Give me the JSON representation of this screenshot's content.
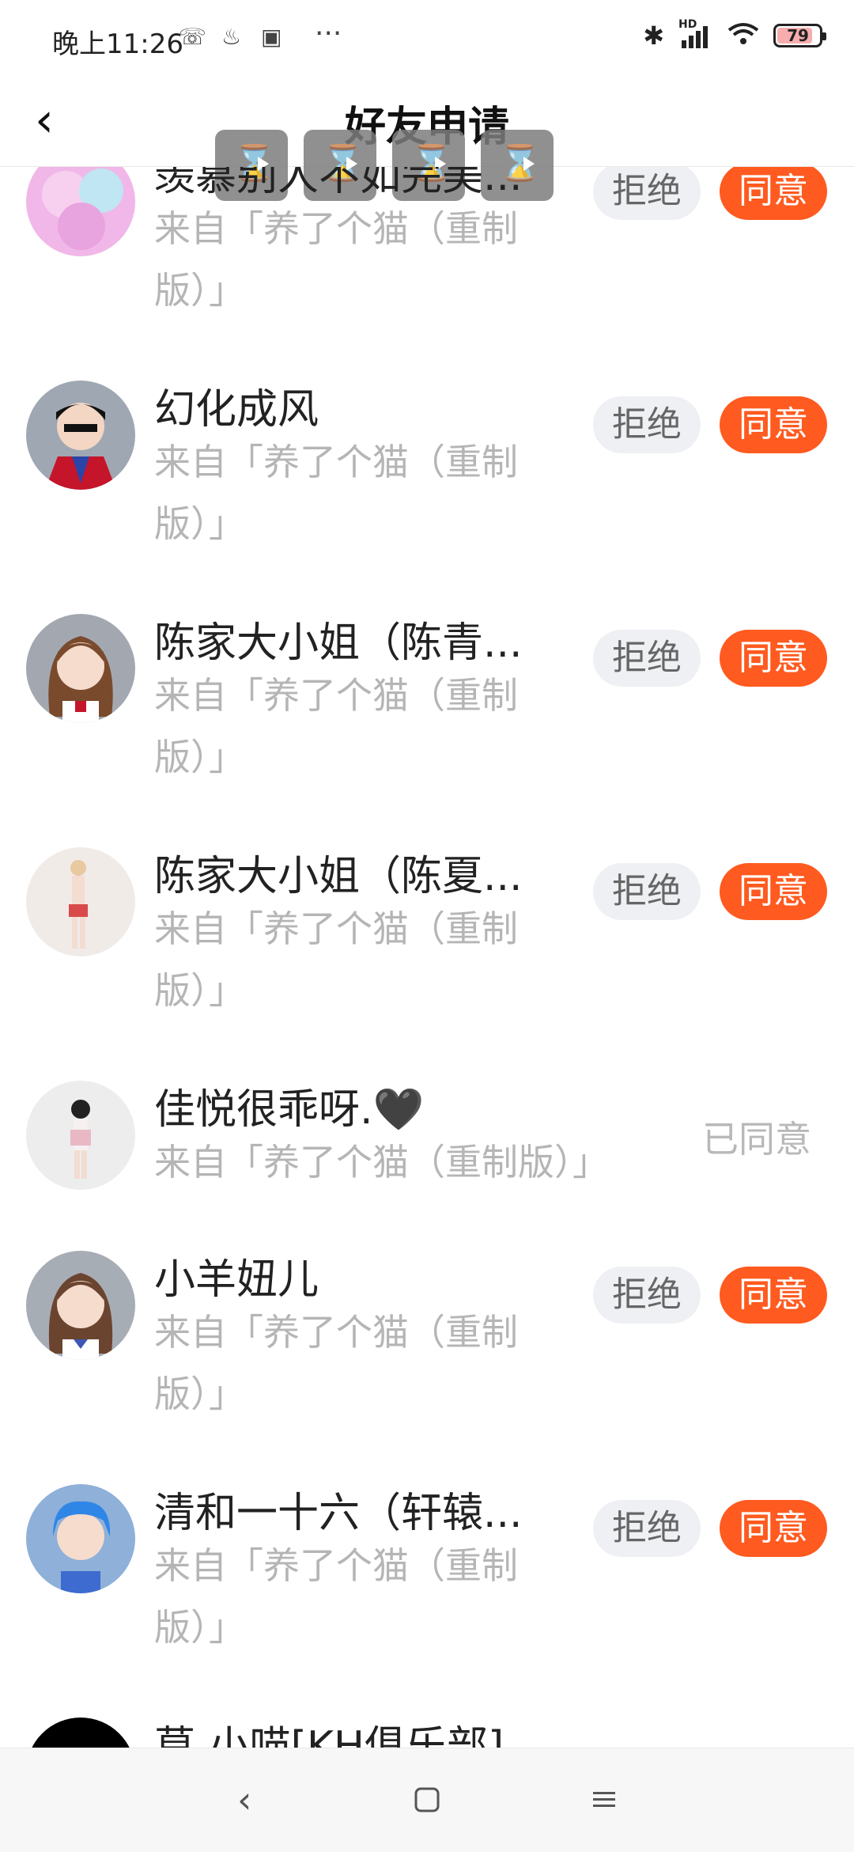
{
  "status": {
    "time": "晚上11:26",
    "dots": "···",
    "hd": "HD",
    "battery": "79"
  },
  "header": {
    "title": "好友申请"
  },
  "items": [
    {
      "name": "羡慕别人不如完美...",
      "source": "来自「养了个猫（重制版）」",
      "reject": "拒绝",
      "accept": "同意",
      "avatar_color": "#f1b7e8"
    },
    {
      "name": "幻化成风",
      "source": "来自「养了个猫（重制版）」",
      "reject": "拒绝",
      "accept": "同意",
      "avatar_color": "#9fa7b2"
    },
    {
      "name": "陈家大小姐（陈青...",
      "source": "来自「养了个猫（重制版）」",
      "reject": "拒绝",
      "accept": "同意",
      "avatar_color": "#a3a8b0"
    },
    {
      "name": "陈家大小姐（陈夏...",
      "source": "来自「养了个猫（重制版）」",
      "reject": "拒绝",
      "accept": "同意",
      "avatar_color": "#f1ebe8"
    },
    {
      "name": "佳悦很乖呀.🖤",
      "source": "来自「养了个猫（重制版）」",
      "status": "已同意",
      "avatar_color": "#ededed"
    },
    {
      "name": "小羊妞儿",
      "source": "来自「养了个猫（重制版）」",
      "reject": "拒绝",
      "accept": "同意",
      "avatar_color": "#a7adb5"
    },
    {
      "name": "清和一十六（轩辕...",
      "source": "来自「养了个猫（重制版）」",
      "reject": "拒绝",
      "accept": "同意",
      "avatar_color": "#8fb0d8"
    },
    {
      "name": "莫 小喵[KH俱乐部]",
      "avatar_color": "#000000"
    }
  ],
  "colors": {
    "accent": "#ff5a1f",
    "reject_bg": "#eef0f3",
    "muted": "#b5b5b5"
  }
}
